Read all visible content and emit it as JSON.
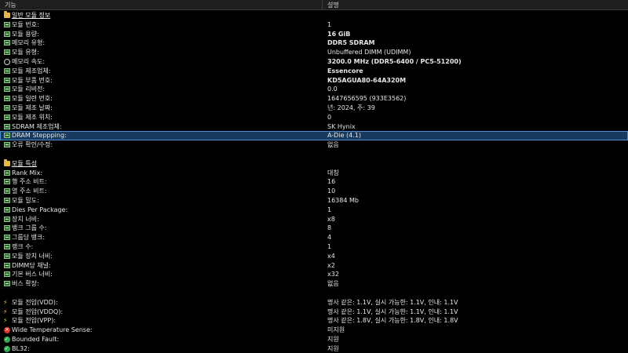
{
  "columns": {
    "feature": "기능",
    "description": "설명"
  },
  "rows": [
    {
      "label": "일반 모듈 정보",
      "value": "",
      "icon": "folder-icon",
      "type": "section"
    },
    {
      "label": "모듈 번호:",
      "value": "1",
      "icon": "memory-module-icon"
    },
    {
      "label": "모듈 용량:",
      "value": "16 GiB",
      "icon": "memory-module-icon",
      "bold": true
    },
    {
      "label": "메모리 유형:",
      "value": "DDR5 SDRAM",
      "icon": "memory-module-icon",
      "bold": true
    },
    {
      "label": "모듈 유형:",
      "value": "Unbuffered DIMM (UDIMM)",
      "icon": "memory-module-icon"
    },
    {
      "label": "메모리 속도:",
      "value": "3200.0 MHz (DDR5-6400 / PC5-51200)",
      "icon": "clock-icon",
      "bold": true
    },
    {
      "label": "모듈 제조업체:",
      "value": "Essencore",
      "icon": "memory-module-icon",
      "bold": true
    },
    {
      "label": "모듈 부품 번호:",
      "value": "KD5AGUA80-64A320M",
      "icon": "memory-module-icon",
      "bold": true
    },
    {
      "label": "모듈 리비전:",
      "value": "0.0",
      "icon": "memory-module-icon"
    },
    {
      "label": "모듈 일련 번호:",
      "value": "1647656595 (933E3562)",
      "icon": "memory-module-icon"
    },
    {
      "label": "모듈 제조 날짜:",
      "value": "년: 2024, 주: 39",
      "icon": "memory-module-icon"
    },
    {
      "label": "모듈 제조 위치:",
      "value": "0",
      "icon": "memory-module-icon"
    },
    {
      "label": "SDRAM 제조업체:",
      "value": "SK Hynix",
      "icon": "memory-module-icon"
    },
    {
      "label": "DRAM Steppping:",
      "value": "A-Die (4.1)",
      "icon": "memory-module-icon",
      "selected": true
    },
    {
      "label": "오류 확인/수정:",
      "value": "없음",
      "icon": "memory-module-icon"
    },
    {
      "type": "blank",
      "label": "",
      "value": ""
    },
    {
      "label": "모듈 특성",
      "value": "",
      "icon": "folder-icon",
      "type": "section"
    },
    {
      "label": "Rank Mix:",
      "value": "대칭",
      "icon": "memory-module-icon"
    },
    {
      "label": "행 주소 비트:",
      "value": "16",
      "icon": "memory-module-icon"
    },
    {
      "label": "열 주소 비트:",
      "value": "10",
      "icon": "memory-module-icon"
    },
    {
      "label": "모듈 밀도:",
      "value": "16384 Mb",
      "icon": "memory-module-icon"
    },
    {
      "label": "Dies Per Package:",
      "value": "1",
      "icon": "memory-module-icon"
    },
    {
      "label": "장치 너비:",
      "value": "x8",
      "icon": "memory-module-icon"
    },
    {
      "label": "뱅크 그룹 수:",
      "value": "8",
      "icon": "memory-module-icon"
    },
    {
      "label": "그룹당 뱅크:",
      "value": "4",
      "icon": "memory-module-icon"
    },
    {
      "label": "랭크 수:",
      "value": "1",
      "icon": "memory-module-icon"
    },
    {
      "label": "모듈 장치 너비:",
      "value": "x4",
      "icon": "memory-module-icon"
    },
    {
      "label": "DIMM당 채널:",
      "value": "x2",
      "icon": "memory-module-icon"
    },
    {
      "label": "기본 버스 너비:",
      "value": "x32",
      "icon": "memory-module-icon"
    },
    {
      "label": "버스 확장:",
      "value": "없음",
      "icon": "memory-module-icon"
    },
    {
      "type": "blank",
      "label": "",
      "value": ""
    },
    {
      "label": "모듈 전압(VDD):",
      "value": "명사 같은: 1.1V, 실시 가능한: 1.1V, 인내: 1.1V",
      "icon": "lightning-icon"
    },
    {
      "label": "모듈 전압(VDDQ):",
      "value": "명사 같은: 1.1V, 실시 가능한: 1.1V, 인내: 1.1V",
      "icon": "lightning-icon"
    },
    {
      "label": "모듈 전압(VPP):",
      "value": "명사 같은: 1.8V, 실시 가능한: 1.8V, 인내: 1.8V",
      "icon": "lightning-icon"
    },
    {
      "label": "Wide Temperature Sense:",
      "value": "미지원",
      "icon": "unsupported-icon"
    },
    {
      "label": "Bounded Fault:",
      "value": "지원",
      "icon": "supported-icon"
    },
    {
      "label": "BL32:",
      "value": "지원",
      "icon": "supported-icon"
    }
  ]
}
